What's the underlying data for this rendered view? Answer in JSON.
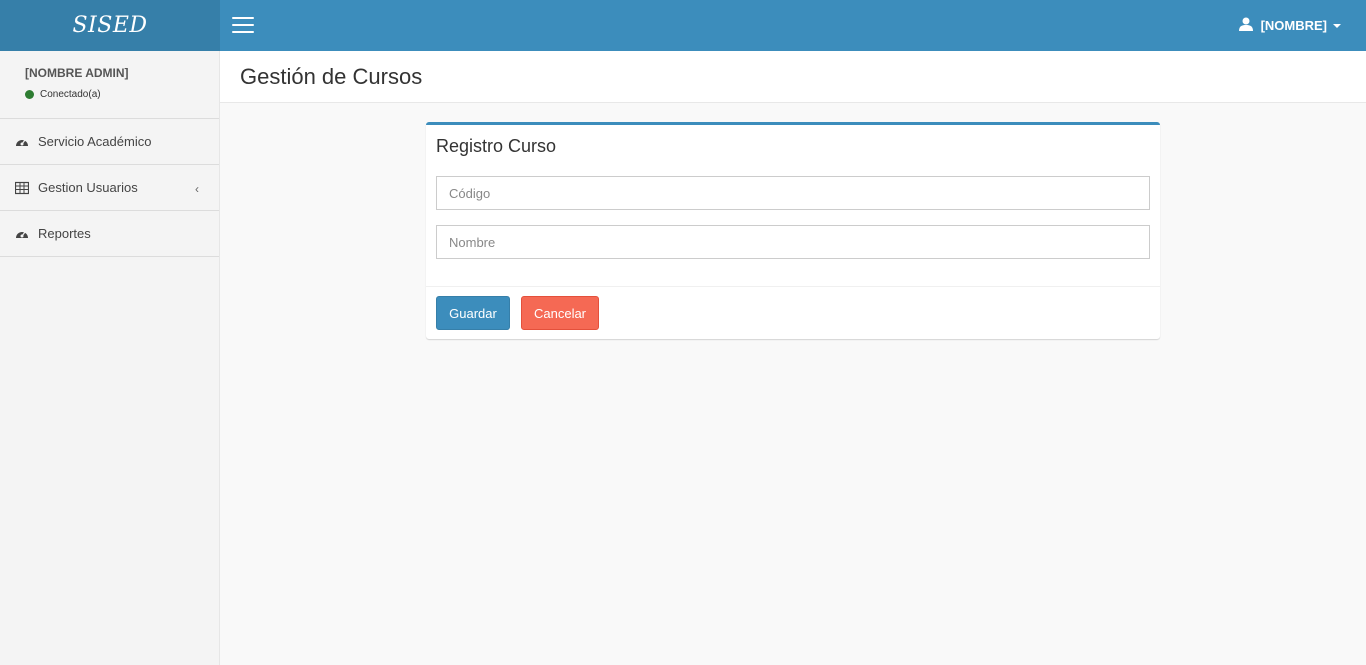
{
  "header": {
    "logo": "SISED",
    "user_label": "[NOMBRE]"
  },
  "sidebar": {
    "user_name": "[NOMBRE ADMIN]",
    "status": "Conectado(a)",
    "items": [
      {
        "label": "Servicio Académico",
        "icon": "dashboard-icon"
      },
      {
        "label": "Gestion Usuarios",
        "icon": "table-icon"
      },
      {
        "label": "Reportes",
        "icon": "dashboard-icon"
      }
    ]
  },
  "main": {
    "page_title": "Gestión de Cursos",
    "form": {
      "title": "Registro Curso",
      "code_placeholder": "Código",
      "name_placeholder": "Nombre",
      "save_label": "Guardar",
      "cancel_label": "Cancelar"
    }
  },
  "colors": {
    "navbar": "#3c8dbc",
    "logo_bg": "#367fa9",
    "status_online": "#2e7d32",
    "danger": "#f56954"
  }
}
